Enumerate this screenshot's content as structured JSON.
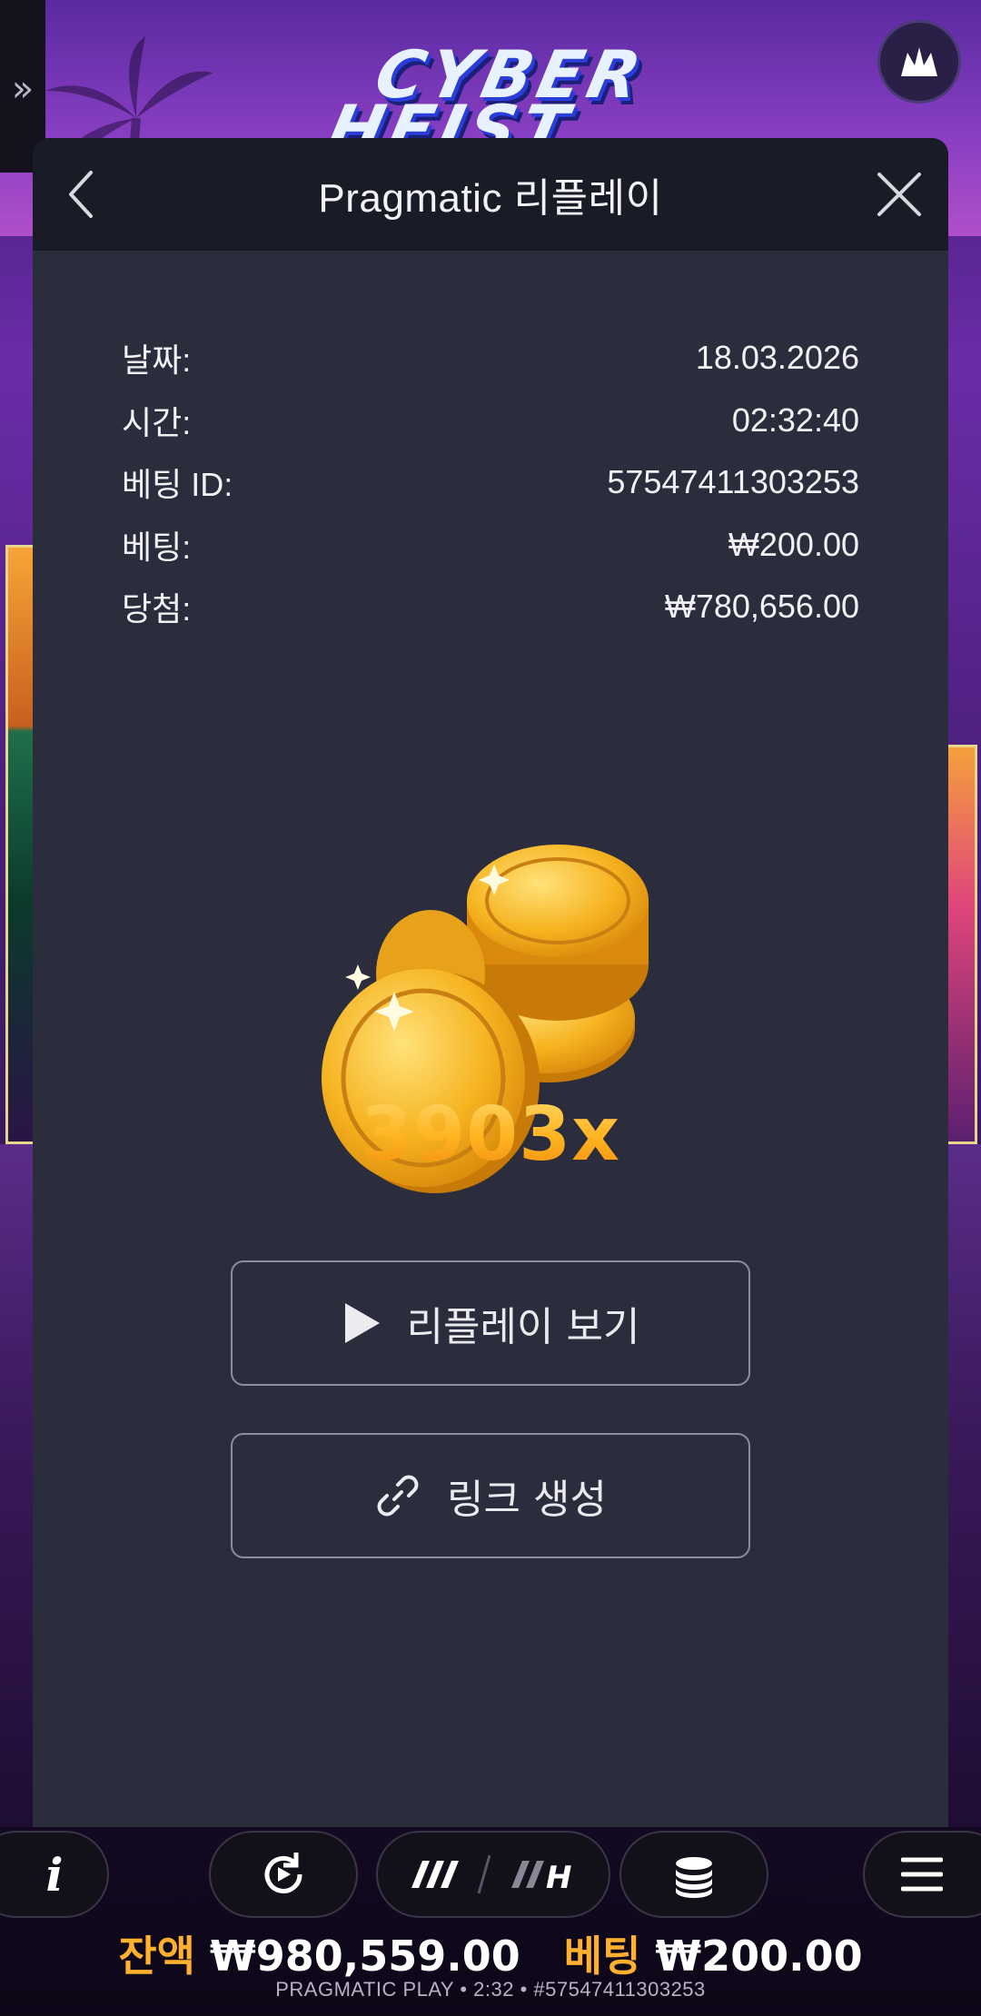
{
  "background": {
    "logo_row1": "CYBER",
    "logo_row2": "HEIST"
  },
  "modal": {
    "title": "Pragmatic 리플레이",
    "info": [
      {
        "label": "날짜:",
        "value": "18.03.2026"
      },
      {
        "label": "시간:",
        "value": "02:32:40"
      },
      {
        "label": "베팅 ID:",
        "value": "57547411303253"
      },
      {
        "label": "베팅:",
        "value": "₩200.00"
      },
      {
        "label": "당첨:",
        "value": "₩780,656.00"
      }
    ],
    "multiplier": "3903x",
    "replay_button": "리플레이 보기",
    "link_button": "링크 생성"
  },
  "bottom": {
    "balance_label": "잔액",
    "balance_value": "₩980,559.00",
    "bet_label": "베팅",
    "bet_value": "₩200.00",
    "footer": "PRAGMATIC PLAY • 2:32 • #57547411303253"
  },
  "colors": {
    "modal_bg": "#2b2d3c",
    "header_bg": "#191b26",
    "accent_gold": "#ffb72a"
  },
  "icons": [
    "chevron-double-right-icon",
    "pragmatic-crown-icon",
    "back-chevron-icon",
    "close-icon",
    "coins-icon",
    "play-icon",
    "link-icon",
    "info-icon",
    "autoplay-icon",
    "turbo-icon",
    "coin-stack-icon",
    "menu-icon"
  ]
}
